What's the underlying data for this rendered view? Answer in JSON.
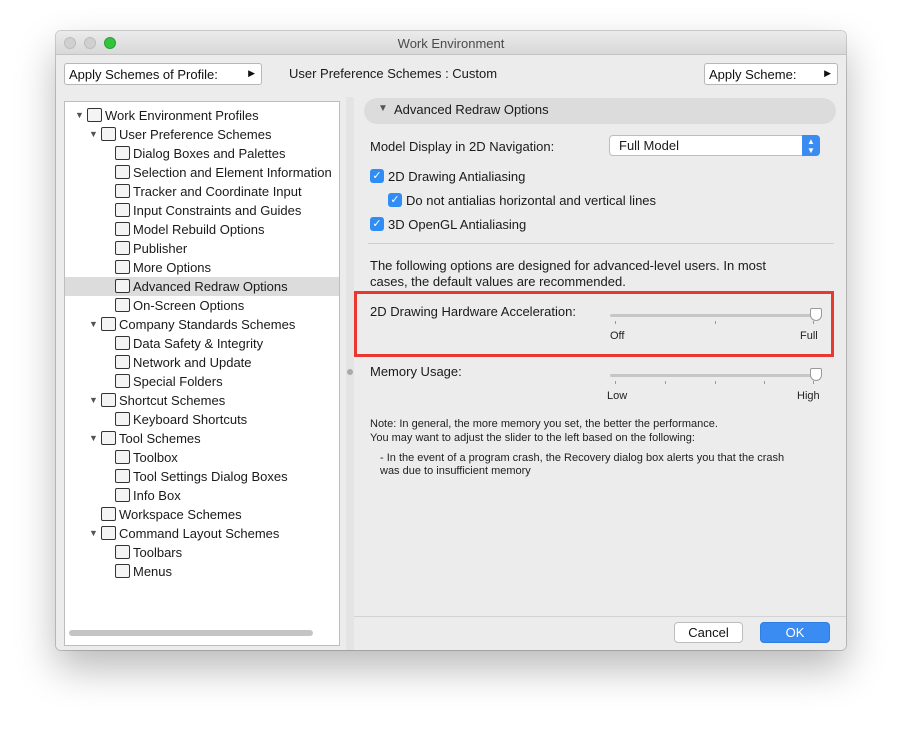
{
  "window": {
    "title": "Work Environment"
  },
  "toolbar": {
    "apply_profile_label": "Apply Schemes of Profile:",
    "scheme_status": "User Preference Schemes : Custom",
    "apply_scheme_label": "Apply Scheme:"
  },
  "tree": {
    "items": [
      {
        "label": "Work Environment Profiles",
        "level": 0,
        "disclosure": "open"
      },
      {
        "label": "User Preference Schemes",
        "level": 1,
        "disclosure": "open"
      },
      {
        "label": "Dialog Boxes and Palettes",
        "level": 2
      },
      {
        "label": "Selection and Element Information",
        "level": 2
      },
      {
        "label": "Tracker and Coordinate Input",
        "level": 2
      },
      {
        "label": "Input Constraints and Guides",
        "level": 2
      },
      {
        "label": "Model Rebuild Options",
        "level": 2
      },
      {
        "label": "Publisher",
        "level": 2
      },
      {
        "label": "More Options",
        "level": 2
      },
      {
        "label": "Advanced Redraw Options",
        "level": 2,
        "selected": true
      },
      {
        "label": "On-Screen Options",
        "level": 2
      },
      {
        "label": "Company Standards Schemes",
        "level": 1,
        "disclosure": "open"
      },
      {
        "label": "Data Safety & Integrity",
        "level": 2
      },
      {
        "label": "Network and Update",
        "level": 2
      },
      {
        "label": "Special Folders",
        "level": 2
      },
      {
        "label": "Shortcut Schemes",
        "level": 1,
        "disclosure": "open"
      },
      {
        "label": "Keyboard Shortcuts",
        "level": 2
      },
      {
        "label": "Tool Schemes",
        "level": 1,
        "disclosure": "open"
      },
      {
        "label": "Toolbox",
        "level": 2
      },
      {
        "label": "Tool Settings Dialog Boxes",
        "level": 2
      },
      {
        "label": "Info Box",
        "level": 2
      },
      {
        "label": "Workspace Schemes",
        "level": 1
      },
      {
        "label": "Command Layout Schemes",
        "level": 1,
        "disclosure": "open"
      },
      {
        "label": "Toolbars",
        "level": 2
      },
      {
        "label": "Menus",
        "level": 2
      }
    ]
  },
  "section": {
    "title": "Advanced Redraw Options"
  },
  "settings": {
    "model_display_label": "Model Display in 2D Navigation:",
    "model_display_value": "Full Model",
    "aa2d_label": "2D Drawing Antialiasing",
    "aa2d_checked": true,
    "no_hv_label": "Do not antialias horizontal and vertical lines",
    "no_hv_checked": true,
    "aa3d_label": "3D OpenGL Antialiasing",
    "aa3d_checked": true,
    "advanced_note_1": "The following options are designed for advanced-level users. In most",
    "advanced_note_2": "cases, the default values are recommended.",
    "hw_accel_label": "2D Drawing Hardware Acceleration:",
    "hw_accel_min": "Off",
    "hw_accel_max": "Full",
    "hw_accel_value": 1.0,
    "memory_label": "Memory Usage:",
    "memory_min": "Low",
    "memory_max": "High",
    "memory_value": 1.0,
    "note_1": "Note: In general, the more memory you set, the better the performance.",
    "note_2": "You may want to adjust the slider to the left based on the following:",
    "note_3": "- In the event of a program crash, the Recovery dialog box alerts you that the crash",
    "note_4": "was due to insufficient memory"
  },
  "buttons": {
    "cancel": "Cancel",
    "ok": "OK"
  },
  "colors": {
    "accent": "#3b8cf2",
    "highlight": "#e8382f"
  }
}
